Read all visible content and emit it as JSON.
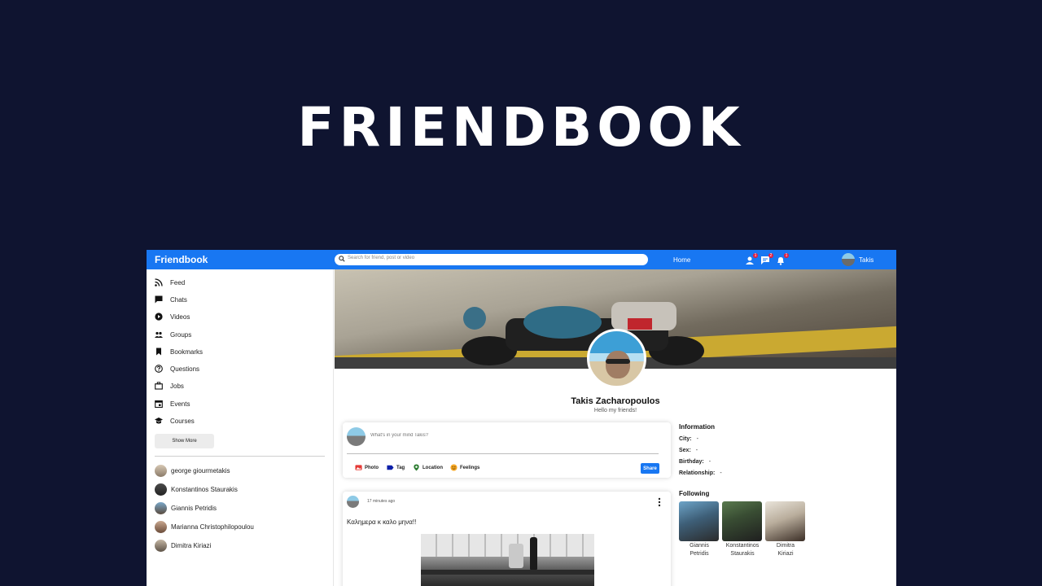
{
  "hero": {
    "title": "FRIENDBOOK"
  },
  "topbar": {
    "logo": "Friendbook",
    "search_placeholder": "Search for friend, post or video",
    "home_label": "Home",
    "badges": {
      "friends": "1",
      "messages": "2",
      "notifications": "1"
    },
    "user_name": "Takis",
    "accent_color": "#1877f2"
  },
  "sidebar": {
    "items": [
      {
        "label": "Feed",
        "icon": "rss-icon"
      },
      {
        "label": "Chats",
        "icon": "chat-icon"
      },
      {
        "label": "Videos",
        "icon": "play-icon"
      },
      {
        "label": "Groups",
        "icon": "group-icon"
      },
      {
        "label": "Bookmarks",
        "icon": "bookmark-icon"
      },
      {
        "label": "Questions",
        "icon": "help-icon"
      },
      {
        "label": "Jobs",
        "icon": "briefcase-icon"
      },
      {
        "label": "Events",
        "icon": "calendar-icon"
      },
      {
        "label": "Courses",
        "icon": "school-icon"
      }
    ],
    "show_more": "Show More",
    "friends": [
      {
        "name": "george giourmetakis"
      },
      {
        "name": "Konstantinos Staurakis"
      },
      {
        "name": "Giannis Petridis"
      },
      {
        "name": "Marianna Christophilopoulou"
      },
      {
        "name": "Dimitra Kiriazi"
      }
    ]
  },
  "profile": {
    "name": "Takis Zacharopoulos",
    "bio": "Hello my friends!"
  },
  "share": {
    "placeholder": "What's in your mind Takis?",
    "options": [
      {
        "label": "Photo",
        "icon": "photo-icon",
        "color": "#e53935"
      },
      {
        "label": "Tag",
        "icon": "label-icon",
        "color": "#1a237e"
      },
      {
        "label": "Location",
        "icon": "location-icon",
        "color": "#2e7d32"
      },
      {
        "label": "Feelings",
        "icon": "emoji-icon",
        "color": "#f5a623"
      }
    ],
    "button": "Share"
  },
  "post": {
    "time": "17 minutes ago",
    "text": "Καλημερα κ καλο μηνα!!"
  },
  "info": {
    "title": "Information",
    "rows": [
      {
        "key": "City:",
        "value": "-"
      },
      {
        "key": "Sex:",
        "value": "-"
      },
      {
        "key": "Birthday:",
        "value": "-"
      },
      {
        "key": "Relationship:",
        "value": "-"
      }
    ]
  },
  "following": {
    "title": "Following",
    "people": [
      {
        "first": "Giannis",
        "last": "Petridis"
      },
      {
        "first": "Konstantinos",
        "last": "Staurakis"
      },
      {
        "first": "Dimitra",
        "last": "Kiriazi"
      }
    ]
  }
}
